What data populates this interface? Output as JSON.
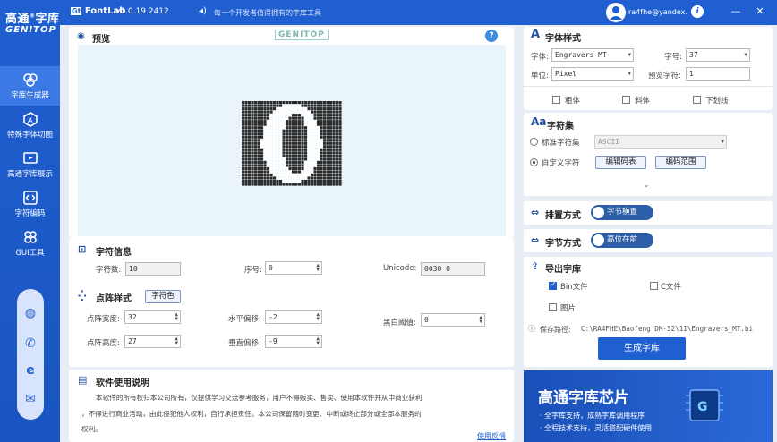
{
  "app": {
    "logo_line1": "高通",
    "logo_sup": "®",
    "logo_line2": "字库",
    "logo_sub": "GENITOP",
    "brand": "FontLab",
    "version": "v1.0.19.2412",
    "announcement": "每一个开发者值得拥有的字库工具",
    "user": "ra4fhe@yandex.",
    "info_icon": "info-icon",
    "minimize": "—",
    "close": "✕"
  },
  "sidebar": {
    "items": [
      {
        "label": "字库生成器",
        "icon": "font-generator-icon",
        "active": true
      },
      {
        "label": "特殊字体切图",
        "icon": "special-font-icon",
        "active": false
      },
      {
        "label": "高通字库展示",
        "icon": "font-display-icon",
        "active": false
      },
      {
        "label": "字符编码",
        "icon": "char-encoding-icon",
        "active": false
      },
      {
        "label": "GUI工具",
        "icon": "gui-tools-icon",
        "active": false
      }
    ],
    "contacts": [
      "wechat-icon",
      "phone-icon",
      "browser-icon",
      "mail-icon"
    ]
  },
  "preview": {
    "title": "预览",
    "watermark": "GENITOP",
    "help": "?",
    "glyph": "0",
    "grid_cols": 32,
    "grid_rows": 27
  },
  "char_info": {
    "title": "字符信息",
    "count_label": "字符数",
    "count_value": "10",
    "index_label": "序号",
    "index_value": "0",
    "unicode_label": "Unicode",
    "unicode_value": "0030 0"
  },
  "dot_style": {
    "title": "点阵样式",
    "color_btn": "字符色",
    "width_label": "点阵宽度",
    "width_value": "32",
    "height_label": "点阵高度",
    "height_value": "27",
    "hoffset_label": "水平偏移",
    "hoffset_value": "-2",
    "voffset_label": "垂直偏移",
    "voffset_value": "-9",
    "threshold_label": "黑白阈值",
    "threshold_value": "0"
  },
  "usage": {
    "title": "软件使用说明",
    "text1": "本软件的所有权归本公司所有，仅提供学习交流参考服务，用户不得贩卖、售卖、使用本软件并从中商业获利",
    "text2": "，不得进行商业活动，由此侵犯他人权利，自行承担责任。本公司保留随时变更、中断或终止部分或全部本服务的",
    "text3": "权利。",
    "feedback": "使用反馈"
  },
  "font_style": {
    "title": "字体样式",
    "font_label": "字体",
    "font_value": "Engravers MT",
    "size_label": "字号",
    "size_value": "37",
    "unit_label": "单位",
    "unit_value": "Pixel",
    "preview_label": "预览字符",
    "preview_value": "1",
    "bold": "粗体",
    "italic": "斜体",
    "underline": "下划线"
  },
  "charset": {
    "title": "字符集",
    "standard_label": "标准字符集",
    "standard_value": "ASCII",
    "custom_label": "自定义字符",
    "edit_btn": "编辑码表",
    "range_btn": "编码范围"
  },
  "layout": {
    "title": "排置方式",
    "toggle": "字节横置"
  },
  "byte_order": {
    "title": "字节方式",
    "toggle": "高位在前"
  },
  "export": {
    "title": "导出字库",
    "bin": "Bin文件",
    "c": "C文件",
    "image": "图片",
    "path_label": "保存路径",
    "path_value": "C:\\RA4FHE\\Baofeng DM-32\\11\\Engravers_MT.bi",
    "generate": "生成字库"
  },
  "ad": {
    "title": "高通字库芯片",
    "line1": "· 全字库支持，成熟字库调用程序",
    "line2": "· 全程技术支持，灵活搭配硬件使用"
  },
  "colors": {
    "primary": "#1f5fd0",
    "preview_bg": "#eaf4fb"
  }
}
